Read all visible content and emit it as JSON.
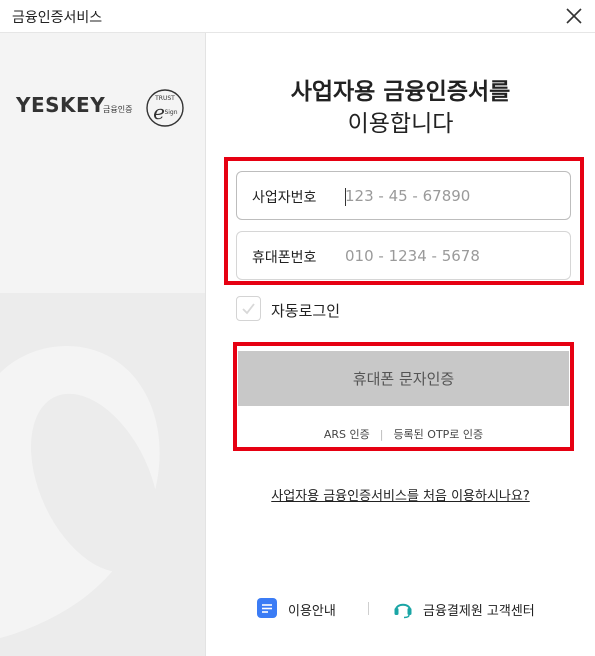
{
  "window": {
    "title": "금융인증서비스"
  },
  "brand": {
    "wordmark": "YESKEY",
    "sub_label": "금융인증",
    "seal_top": "TRUST",
    "seal_letter": "e",
    "seal_bottom": "Sign"
  },
  "heading": {
    "line1": "사업자용 금융인증서를",
    "line2": "이용합니다"
  },
  "form": {
    "business_number": {
      "label": "사업자번호",
      "placeholder": "123 - 45 - 67890",
      "value": ""
    },
    "phone_number": {
      "label": "휴대폰번호",
      "placeholder": "010 - 1234 - 5678",
      "value": ""
    },
    "auto_login": {
      "label": "자동로그인",
      "checked": false
    }
  },
  "actions": {
    "sms_auth": "휴대폰 문자인증",
    "ars_auth": "ARS 인증",
    "otp_auth": "등록된 OTP로 인증",
    "first_time": "사업자용 금융인증서비스를 처음 이용하시나요?"
  },
  "footer": {
    "guide": "이용안내",
    "support": "금융결제원 고객센터"
  },
  "colors": {
    "highlight": "#e60012",
    "button_bg": "#c8c8c8",
    "guide_icon": "#3b7cf5",
    "support_icon": "#1aa5a5"
  }
}
